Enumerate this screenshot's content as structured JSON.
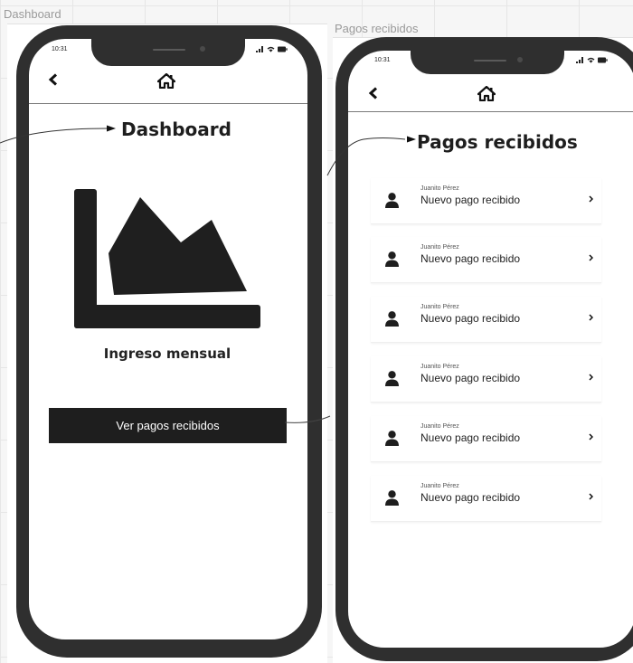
{
  "boards": [
    {
      "label": "Dashboard",
      "status_time": "10:31",
      "title": "Dashboard",
      "chart_caption": "Ingreso mensual",
      "button_label": "Ver pagos recibidos"
    },
    {
      "label": "Pagos recibidos",
      "status_time": "10:31",
      "title": "Pagos recibidos",
      "items": [
        {
          "sender": "Juanito Pérez",
          "message": "Nuevo pago recibido"
        },
        {
          "sender": "Juanito Pérez",
          "message": "Nuevo pago recibido"
        },
        {
          "sender": "Juanito Pérez",
          "message": "Nuevo pago recibido"
        },
        {
          "sender": "Juanito Pérez",
          "message": "Nuevo pago recibido"
        },
        {
          "sender": "Juanito Pérez",
          "message": "Nuevo pago recibido"
        },
        {
          "sender": "Juanito Pérez",
          "message": "Nuevo pago recibido"
        }
      ]
    }
  ],
  "icons": {
    "nav_back": "chevron-left-icon",
    "nav_home": "home-icon",
    "chart": "area-chart-icon",
    "avatar": "user-icon",
    "row_chevron": "chevron-right-icon"
  },
  "colors": {
    "phone_frame": "#2f2f2f",
    "button_bg": "#1e1e1e",
    "canvas_grid": "#e6e6e6"
  }
}
